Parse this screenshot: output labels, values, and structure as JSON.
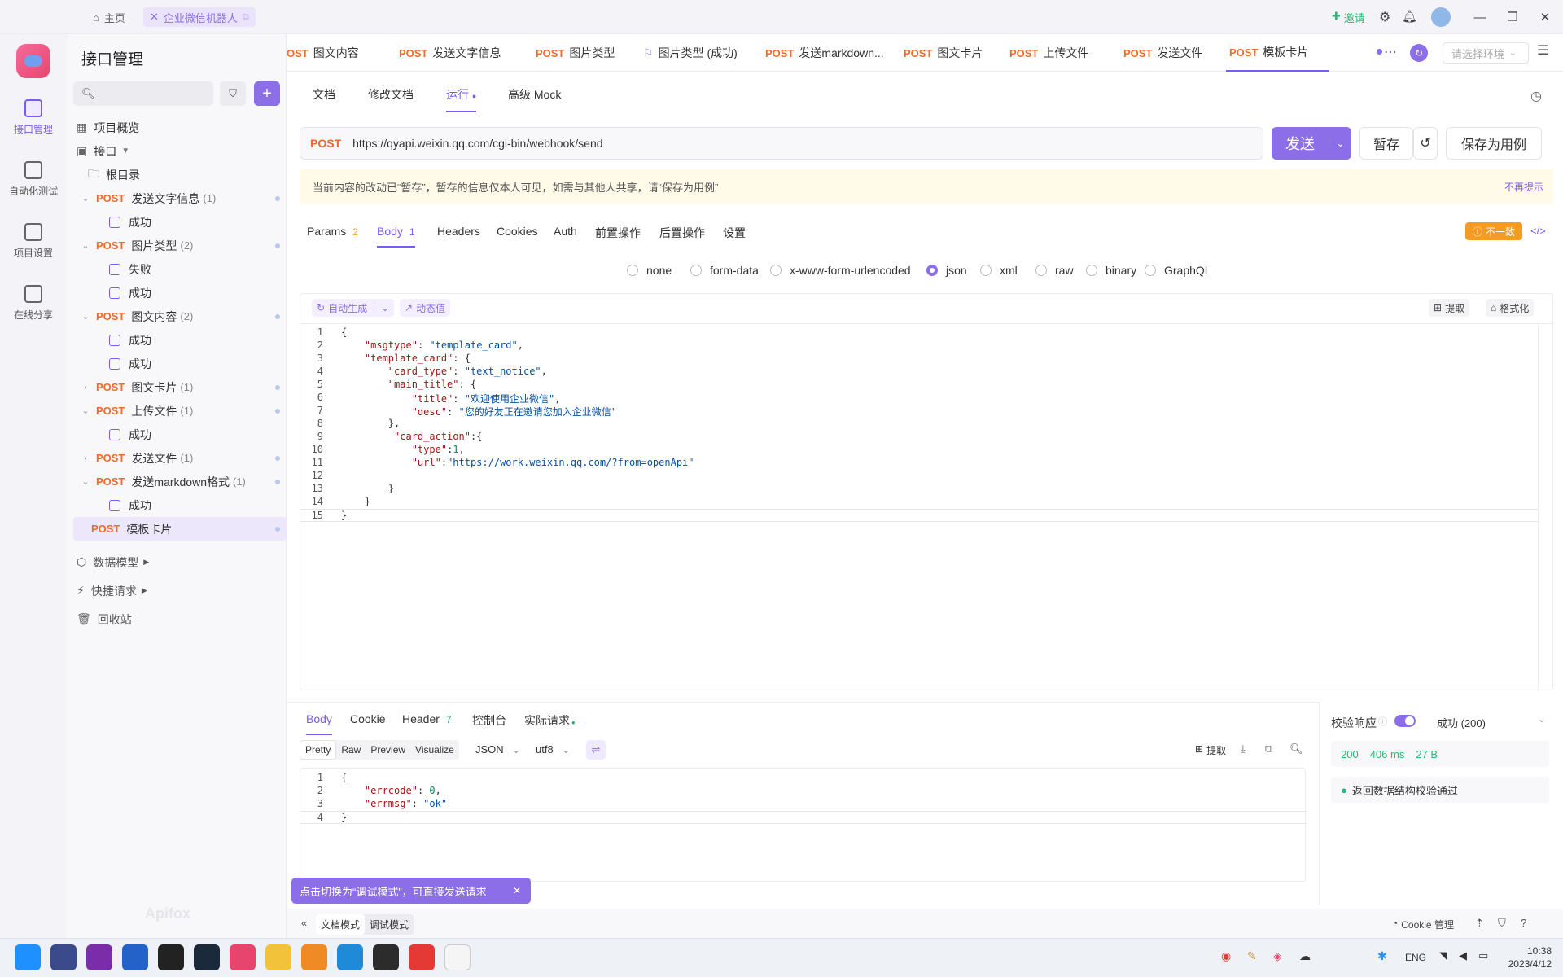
{
  "titlebar": {
    "home": "主页",
    "doc_tab": "企业微信机器人",
    "invite": "邀请"
  },
  "leftnav": [
    {
      "label": "接口管理",
      "icon": "api-manage-icon",
      "active": true
    },
    {
      "label": "自动化测试",
      "icon": "auto-test-icon",
      "active": false
    },
    {
      "label": "项目设置",
      "icon": "project-settings-icon",
      "active": false
    },
    {
      "label": "在线分享",
      "icon": "share-icon",
      "active": false
    }
  ],
  "sidebar": {
    "title": "接口管理",
    "search_placeholder": "",
    "overview": "项目概览",
    "api_root": "接口",
    "root_dir": "根目录",
    "items": [
      {
        "method": "POST",
        "name": "发送文字信息",
        "count": "(1)",
        "expanded": true
      },
      {
        "sub": "成功"
      },
      {
        "method": "POST",
        "name": "图片类型",
        "count": "(2)",
        "expanded": true
      },
      {
        "sub": "失败"
      },
      {
        "sub": "成功"
      },
      {
        "method": "POST",
        "name": "图文内容",
        "count": "(2)",
        "expanded": true
      },
      {
        "sub": "成功"
      },
      {
        "sub": "成功"
      },
      {
        "method": "POST",
        "name": "图文卡片",
        "count": "(1)",
        "expanded": false
      },
      {
        "method": "POST",
        "name": "上传文件",
        "count": "(1)",
        "expanded": true
      },
      {
        "sub": "成功"
      },
      {
        "method": "POST",
        "name": "发送文件",
        "count": "(1)",
        "expanded": false
      },
      {
        "method": "POST",
        "name": "发送markdown格式",
        "count": "(1)",
        "expanded": true
      },
      {
        "sub": "成功"
      },
      {
        "method": "POST",
        "name": "模板卡片",
        "count": "",
        "expanded": false,
        "selected": true
      }
    ],
    "data_model": "数据模型",
    "quick_request": "快捷请求",
    "recycle": "回收站",
    "watermark": "Apifox"
  },
  "toptabs": [
    {
      "method": "OST",
      "label": "图文内容"
    },
    {
      "method": "POST",
      "label": "发送文字信息"
    },
    {
      "method": "POST",
      "label": "图片类型"
    },
    {
      "method": "",
      "label": "图片类型 (成功)"
    },
    {
      "method": "POST",
      "label": "发送markdown..."
    },
    {
      "method": "POST",
      "label": "图文卡片"
    },
    {
      "method": "POST",
      "label": "上传文件"
    },
    {
      "method": "POST",
      "label": "发送文件"
    },
    {
      "method": "POST",
      "label": "模板卡片",
      "active": true
    }
  ],
  "env_placeholder": "请选择环境",
  "subtabs": [
    "文档",
    "修改文档",
    "运行",
    "高级 Mock"
  ],
  "request": {
    "method": "POST",
    "url": "https://qyapi.weixin.qq.com/cgi-bin/webhook/send",
    "send": "发送",
    "save_temp": "暂存",
    "save_case": "保存为用例"
  },
  "notice": {
    "text": "当前内容的改动已“暂存”，暂存的信息仅本人可见，如需与其他人共享，请“保存为用例”",
    "dismiss": "不再提示"
  },
  "req_tabs": [
    {
      "label": "Params",
      "count": "2"
    },
    {
      "label": "Body",
      "count": "1",
      "active": true
    },
    {
      "label": "Headers",
      "count": ""
    },
    {
      "label": "Cookies",
      "count": ""
    },
    {
      "label": "Auth",
      "count": ""
    },
    {
      "label": "前置操作",
      "count": ""
    },
    {
      "label": "后置操作",
      "count": ""
    },
    {
      "label": "设置",
      "count": ""
    }
  ],
  "mismatch_badge": "不一致",
  "body_types": [
    "none",
    "form-data",
    "x-www-form-urlencoded",
    "json",
    "xml",
    "raw",
    "binary",
    "GraphQL"
  ],
  "body_selected": "json",
  "editor": {
    "auto_gen": "自动生成",
    "dynamic": "动态值",
    "extract": "提取",
    "format": "格式化",
    "lines": [
      "{",
      "    \"msgtype\": \"template_card\",",
      "    \"template_card\": {",
      "        \"card_type\": \"text_notice\",",
      "        \"main_title\": {",
      "            \"title\": \"欢迎使用企业微信\",",
      "            \"desc\": \"您的好友正在邀请您加入企业微信\"",
      "        },",
      "         \"card_action\":{",
      "            \"type\":1,",
      "            \"url\":\"https://work.weixin.qq.com/?from=openApi\"",
      "",
      "        }",
      "    }",
      "}"
    ]
  },
  "response": {
    "tabs": [
      {
        "label": "Body",
        "count": "",
        "active": true
      },
      {
        "label": "Cookie",
        "count": ""
      },
      {
        "label": "Header",
        "count": "7"
      },
      {
        "label": "控制台",
        "count": ""
      },
      {
        "label": "实际请求",
        "count": ""
      }
    ],
    "view_modes": [
      "Pretty",
      "Raw",
      "Preview",
      "Visualize"
    ],
    "format": "JSON",
    "encoding": "utf8",
    "extract": "提取",
    "lines": [
      "{",
      "    \"errcode\": 0,",
      "    \"errmsg\": \"ok\"",
      "}"
    ]
  },
  "validation": {
    "label": "校验响应",
    "result": "成功 (200)",
    "status": "200",
    "time": "406 ms",
    "size": "27 B",
    "pass_text": "返回数据结构校验通过"
  },
  "tooltip": "点击切换为“调试模式”，可直接发送请求",
  "bottom": {
    "doc_mode": "文档模式",
    "debug_mode": "调试模式",
    "cookie_mgr": "Cookie 管理"
  },
  "taskbar": {
    "lang": "ENG",
    "time": "10:38",
    "date": "2023/4/12"
  },
  "colors": {
    "accent": "#8b6ee8",
    "post": "#f06b2b",
    "success": "#2bb673",
    "warn": "#f59a23"
  }
}
